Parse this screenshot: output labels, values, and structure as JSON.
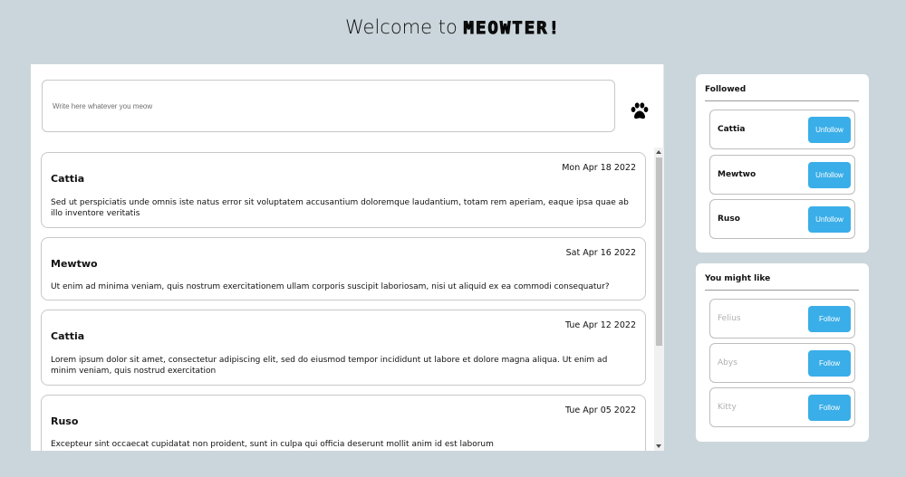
{
  "header": {
    "welcome": "Welcome to",
    "brand": "MEOWTER!"
  },
  "composer": {
    "placeholder": "Write here whatever you meow",
    "submit_icon": "paw-icon"
  },
  "posts": [
    {
      "author": "Cattia",
      "date": "Mon Apr 18 2022",
      "body": "Sed ut perspiciatis unde omnis iste natus error sit voluptatem accusantium doloremque laudantium, totam rem aperiam, eaque ipsa quae ab illo inventore veritatis"
    },
    {
      "author": "Mewtwo",
      "date": "Sat Apr 16 2022",
      "body": "Ut enim ad minima veniam, quis nostrum exercitationem ullam corporis suscipit laboriosam, nisi ut aliquid ex ea commodi consequatur?"
    },
    {
      "author": "Cattia",
      "date": "Tue Apr 12 2022",
      "body": "Lorem ipsum dolor sit amet, consectetur adipiscing elit, sed do eiusmod tempor incididunt ut labore et dolore magna aliqua. Ut enim ad minim veniam, quis nostrud exercitation"
    },
    {
      "author": "Ruso",
      "date": "Tue Apr 05 2022",
      "body": "Excepteur sint occaecat cupidatat non proident, sunt in culpa qui officia deserunt mollit anim id est laborum"
    }
  ],
  "followed": {
    "title": "Followed",
    "users": [
      {
        "name": "Cattia",
        "action": "Unfollow"
      },
      {
        "name": "Mewtwo",
        "action": "Unfollow"
      },
      {
        "name": "Ruso",
        "action": "Unfollow"
      }
    ]
  },
  "suggestions": {
    "title": "You might like",
    "users": [
      {
        "name": "Felius",
        "action": "Follow"
      },
      {
        "name": "Abys",
        "action": "Follow"
      },
      {
        "name": "Kitty",
        "action": "Follow"
      }
    ]
  },
  "colors": {
    "background": "#cbd6dc",
    "accent": "#3aaee8"
  }
}
